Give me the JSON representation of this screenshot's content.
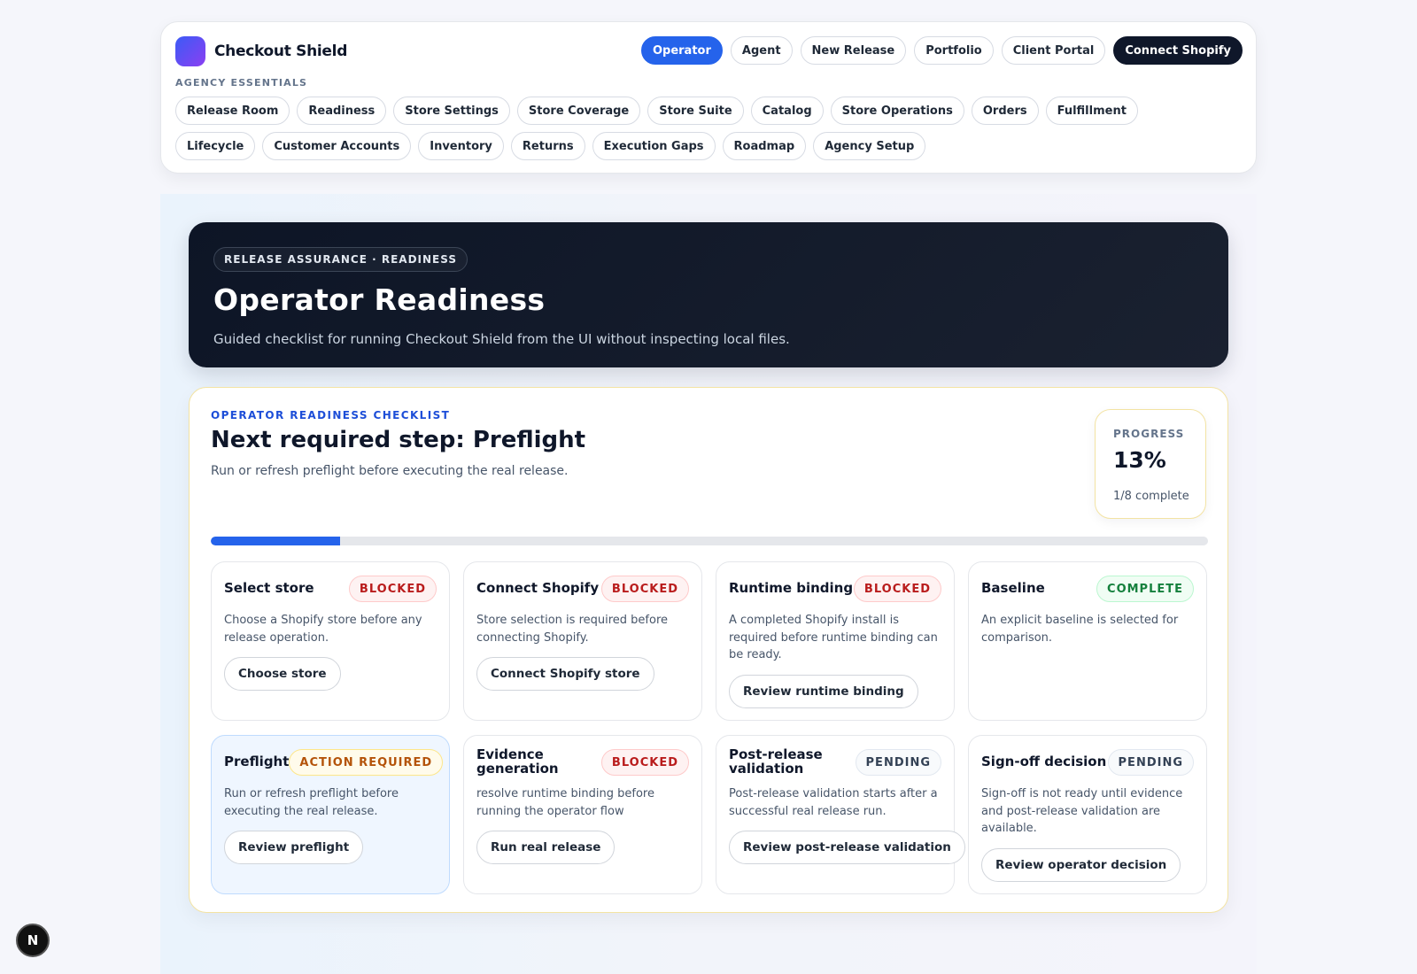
{
  "brand": {
    "name": "Checkout Shield"
  },
  "top_actions": [
    {
      "label": "Operator",
      "style": "active"
    },
    {
      "label": "Agent",
      "style": ""
    },
    {
      "label": "New Release",
      "style": ""
    },
    {
      "label": "Portfolio",
      "style": ""
    },
    {
      "label": "Client Portal",
      "style": ""
    },
    {
      "label": "Connect Shopify",
      "style": "dark"
    }
  ],
  "essentials": {
    "label": "AGENCY ESSENTIALS",
    "items": [
      "Release Room",
      "Readiness",
      "Store Settings",
      "Store Coverage",
      "Store Suite",
      "Catalog",
      "Store Operations",
      "Orders",
      "Fulfillment",
      "Lifecycle",
      "Customer Accounts",
      "Inventory",
      "Returns",
      "Execution Gaps",
      "Roadmap",
      "Agency Setup"
    ]
  },
  "hero": {
    "badge": "RELEASE ASSURANCE · READINESS",
    "title": "Operator Readiness",
    "subtitle": "Guided checklist for running Checkout Shield from the UI without inspecting local files."
  },
  "checklist": {
    "eyebrow": "OPERATOR READINESS CHECKLIST",
    "title": "Next required step: Preflight",
    "description": "Run or refresh preflight before executing the real release.",
    "progress": {
      "label": "PROGRESS",
      "value": "13%",
      "sub": "1/8 complete",
      "fraction": 0.13
    },
    "steps": [
      {
        "title": "Select store",
        "status": "BLOCKED",
        "kind": "blocked",
        "body": "Choose a Shopify store before any release operation.",
        "action": "Choose store"
      },
      {
        "title": "Connect Shopify",
        "status": "BLOCKED",
        "kind": "blocked",
        "body": "Store selection is required before connecting Shopify.",
        "action": "Connect Shopify store"
      },
      {
        "title": "Runtime binding",
        "status": "BLOCKED",
        "kind": "blocked",
        "body": "A completed Shopify install is required before runtime binding can be ready.",
        "action": "Review runtime binding"
      },
      {
        "title": "Baseline",
        "status": "COMPLETE",
        "kind": "complete",
        "body": "An explicit baseline is selected for comparison.",
        "action": ""
      },
      {
        "title": "Preflight",
        "status": "ACTION REQUIRED",
        "kind": "action",
        "body": "Run or refresh preflight before executing the real release.",
        "action": "Review preflight",
        "highlight": true
      },
      {
        "title": "Evidence generation",
        "status": "BLOCKED",
        "kind": "blocked",
        "body": "resolve runtime binding before running the operator flow",
        "action": "Run real release"
      },
      {
        "title": "Post-release validation",
        "status": "PENDING",
        "kind": "pending",
        "body": "Post-release validation starts after a successful real release run.",
        "action": "Review post-release validation"
      },
      {
        "title": "Sign-off decision",
        "status": "PENDING",
        "kind": "pending",
        "body": "Sign-off is not ready until evidence and post-release validation are available.",
        "action": "Review operator decision"
      }
    ]
  },
  "dev_badge": {
    "label": "N"
  }
}
